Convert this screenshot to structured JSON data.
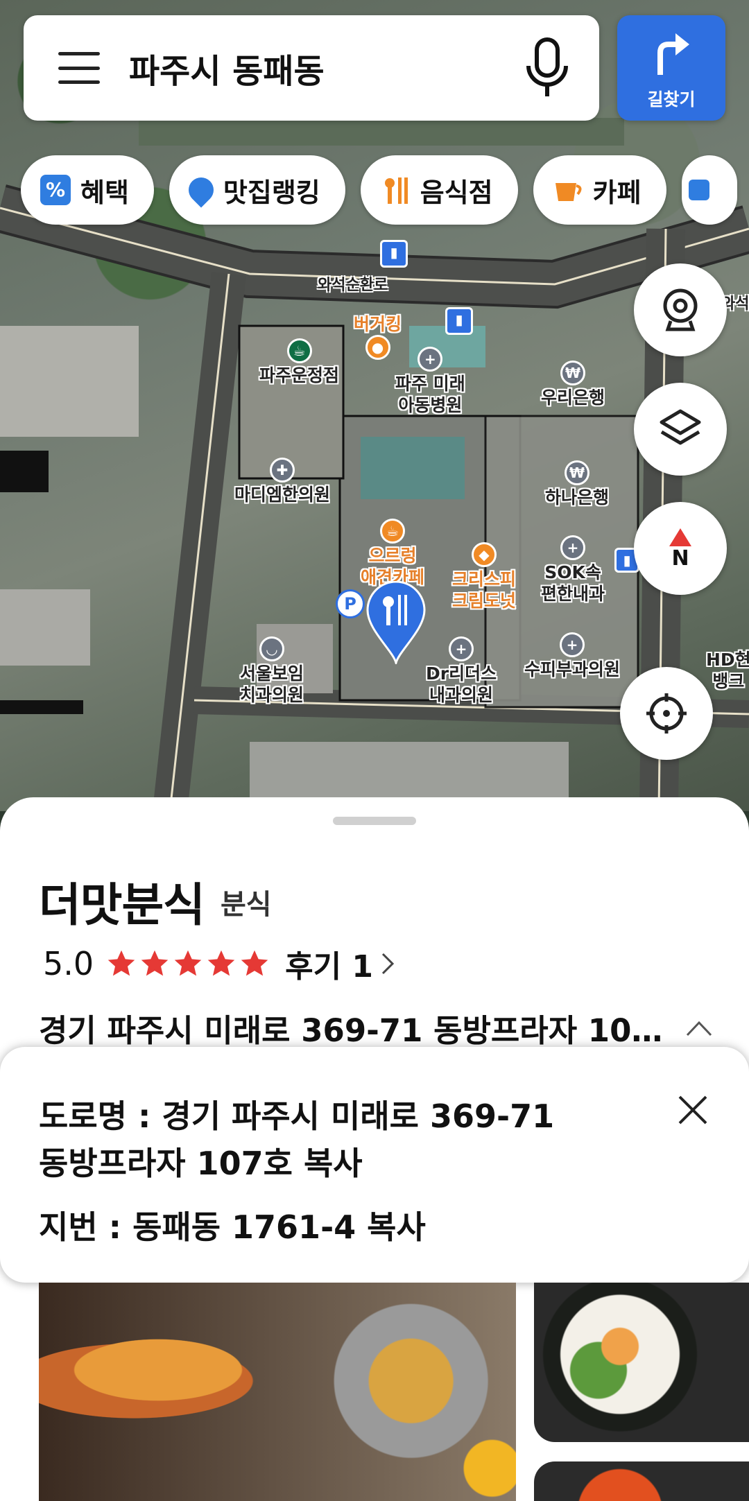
{
  "search": {
    "query": "파주시 동패동"
  },
  "directions": {
    "label": "길찾기"
  },
  "chips": [
    {
      "label": "혜택",
      "icon": "benefit-icon",
      "color": "#2f7de0"
    },
    {
      "label": "맛집랭킹",
      "icon": "ranking-pin-icon",
      "color": "#2f7de0"
    },
    {
      "label": "음식점",
      "icon": "fork-knife-icon",
      "color": "#f08a24"
    },
    {
      "label": "카페",
      "icon": "cup-icon",
      "color": "#f08a24"
    }
  ],
  "map": {
    "roads": [
      "와석순환로",
      "와석"
    ],
    "pois": {
      "burgerking": "버거킹",
      "starbucks": "파주운정점",
      "hospital1_l1": "파주 미래",
      "hospital1_l2": "아동병원",
      "woori": "우리은행",
      "madi": "마디엠한의원",
      "hana": "하나은행",
      "cafe_l1": "으르렁",
      "cafe_l2": "애견카페",
      "krispy_l1": "크리스피",
      "krispy_l2": "크림도넛",
      "sok_l1": "SOK속",
      "sok_l2": "편한내과",
      "seoul_l1": "서울보임",
      "seoul_l2": "치과의원",
      "drl_l1": "Dr리더스",
      "drl_l2": "내과의원",
      "supi": "수피부과의원",
      "hd_l1": "HD현",
      "hd_l2": "뱅크"
    },
    "compass": "N",
    "accent_blue": "#2f6fe0"
  },
  "place": {
    "name": "더맛분식",
    "category": "분식",
    "rating": "5.0",
    "stars": 5,
    "review_label": "후기 1",
    "address": "경기 파주시 미래로 369-71 동방프라자 107…"
  },
  "address_popup": {
    "road_line1": "도로명 : 경기 파주시 미래로 369-71",
    "road_line2": "동방프라자 107호 복사",
    "jibun": "지번 : 동패동 1761-4 복사"
  }
}
